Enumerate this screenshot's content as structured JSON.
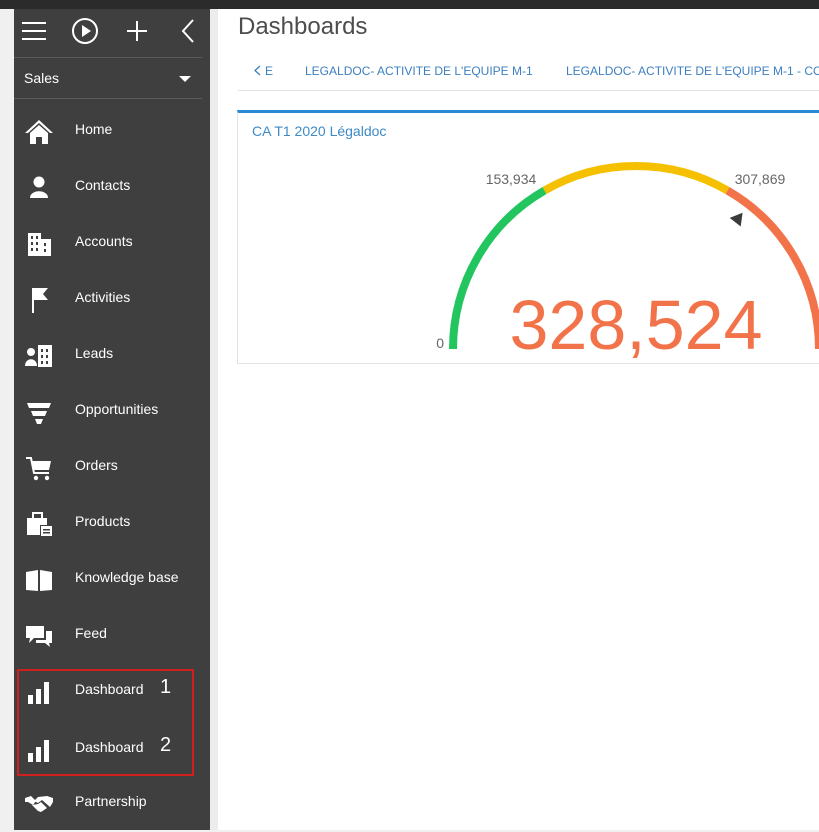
{
  "sidebar": {
    "workplace": "Sales",
    "items": [
      {
        "label": "Home"
      },
      {
        "label": "Contacts"
      },
      {
        "label": "Accounts"
      },
      {
        "label": "Activities"
      },
      {
        "label": "Leads"
      },
      {
        "label": "Opportunities"
      },
      {
        "label": "Orders"
      },
      {
        "label": "Products"
      },
      {
        "label": "Knowledge base"
      },
      {
        "label": "Feed"
      },
      {
        "label": "Dashboard",
        "marker": "1"
      },
      {
        "label": "Dashboard",
        "marker": "2"
      },
      {
        "label": "Partnership"
      }
    ]
  },
  "main": {
    "title": "Dashboards",
    "tabs": {
      "back_label": "E",
      "items": [
        {
          "label": "LEGALDOC- ACTIVITE DE L'EQUIPE M-1"
        },
        {
          "label": "LEGALDOC- ACTIVITE DE L'EQUIPE M-1 - CO"
        }
      ]
    },
    "widget": {
      "title": "CA T1 2020 Légaldoc",
      "gauge": {
        "value": 328524,
        "value_label": "328,524",
        "min_label": "0",
        "mid1_label": "153,934",
        "mid2_label": "307,869",
        "color_green": "#22c55e",
        "color_yellow": "#f5c000",
        "color_orange": "#f2734a",
        "value_color": "#f2734a"
      }
    }
  }
}
